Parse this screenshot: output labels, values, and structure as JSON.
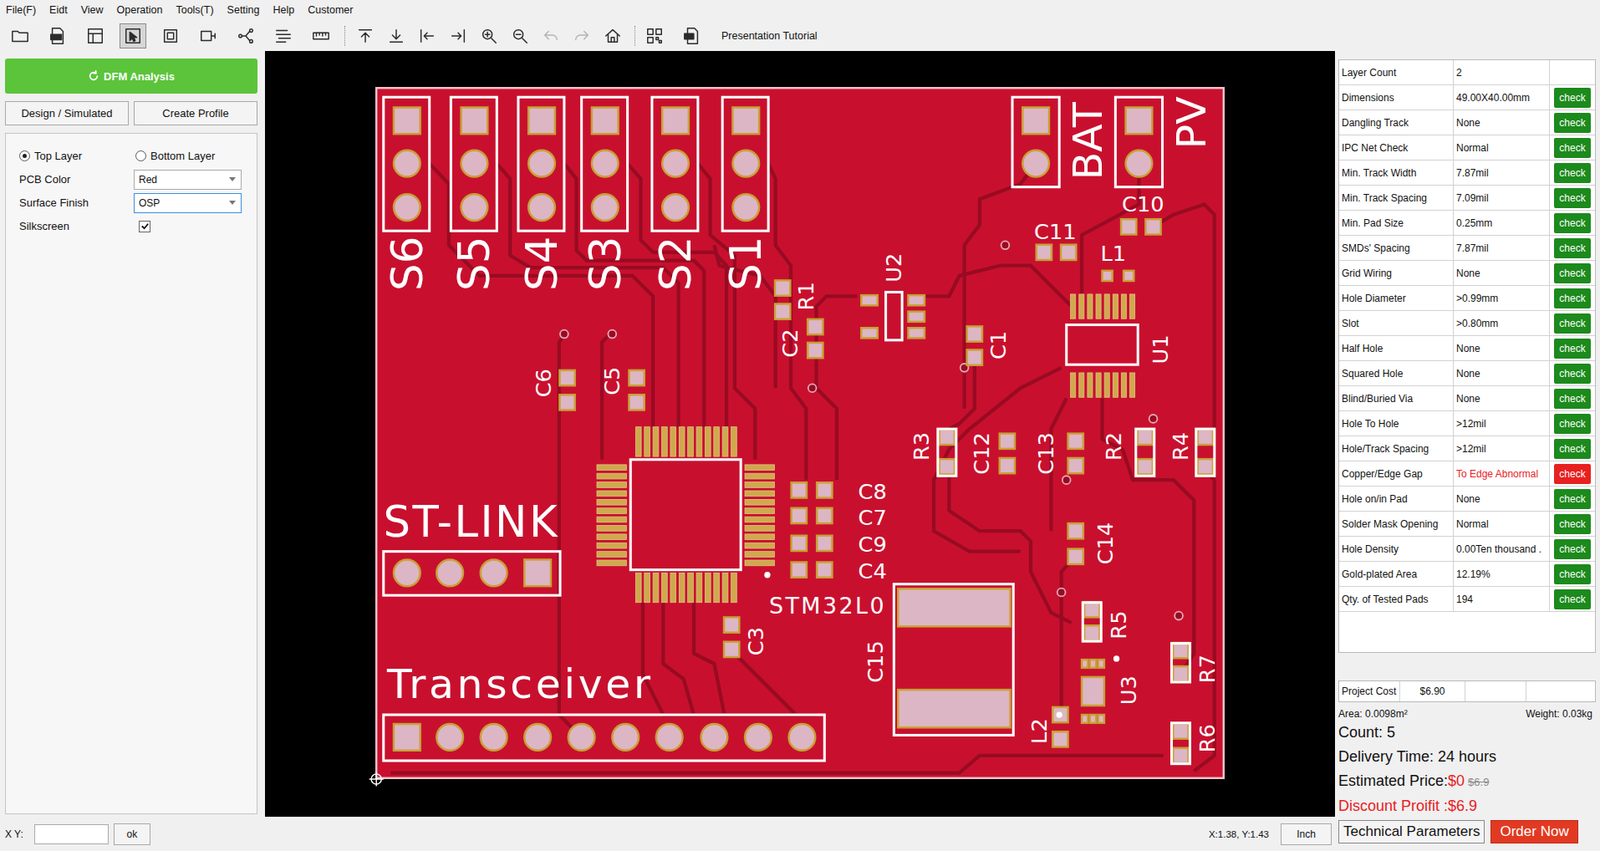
{
  "menu": [
    "File(F)",
    "Eidt",
    "View",
    "Operation",
    "Tools(T)",
    "Setting",
    "Help",
    "Customer"
  ],
  "toolbar": {
    "tools": [
      {
        "selected": false,
        "disabled": false
      },
      {
        "selected": false,
        "disabled": false
      },
      {
        "selected": false,
        "disabled": false
      },
      {
        "selected": true,
        "disabled": false
      },
      {
        "selected": false,
        "disabled": false
      },
      {
        "selected": false,
        "disabled": false
      },
      {
        "selected": false,
        "disabled": false
      },
      {
        "selected": false,
        "disabled": false
      },
      {
        "selected": false,
        "disabled": false
      },
      {
        "selected": false,
        "disabled": false
      },
      {
        "selected": false,
        "disabled": false
      },
      {
        "selected": false,
        "disabled": false
      },
      {
        "selected": false,
        "disabled": false
      },
      {
        "selected": false,
        "disabled": false
      },
      {
        "selected": false,
        "disabled": false
      },
      {
        "selected": false,
        "disabled": true
      },
      {
        "selected": false,
        "disabled": true
      },
      {
        "selected": false,
        "disabled": false
      },
      {
        "selected": false,
        "disabled": false
      },
      {
        "selected": false,
        "disabled": false
      }
    ],
    "tutorial": "Presentation Tutorial"
  },
  "left_panel": {
    "analyze_button": "DFM Analysis",
    "buttons": [
      "Design / Simulated",
      "Create Profile"
    ],
    "layers": [
      {
        "label": "Top Layer",
        "selected": true
      },
      {
        "label": "Bottom Layer",
        "selected": false
      }
    ],
    "fields": [
      {
        "label": "PCB Color",
        "value": "Red",
        "focused": false
      },
      {
        "label": "Surface Finish",
        "value": "OSP",
        "focused": true
      }
    ],
    "silkscreen": {
      "label": "Silkscreen",
      "checked": true
    }
  },
  "board": {
    "labels": [
      {
        "text": "S6",
        "kind": "vertical"
      },
      {
        "text": "S5",
        "kind": "vertical"
      },
      {
        "text": "S4",
        "kind": "vertical"
      },
      {
        "text": "S3",
        "kind": "vertical"
      },
      {
        "text": "S2",
        "kind": "vertical"
      },
      {
        "text": "S1",
        "kind": "vertical"
      },
      {
        "text": "BAT",
        "kind": "vertical"
      },
      {
        "text": "PV",
        "kind": "vertical"
      },
      {
        "text": "C10",
        "kind": "horizontal"
      },
      {
        "text": "C11",
        "kind": "horizontal"
      },
      {
        "text": "L1",
        "kind": "horizontal"
      },
      {
        "text": "U2",
        "kind": "vertical"
      },
      {
        "text": "R1",
        "kind": "vertical"
      },
      {
        "text": "C2",
        "kind": "vertical"
      },
      {
        "text": "C1",
        "kind": "vertical"
      },
      {
        "text": "U1",
        "kind": "vertical"
      },
      {
        "text": "C6",
        "kind": "vertical"
      },
      {
        "text": "C5",
        "kind": "vertical"
      },
      {
        "text": "R3",
        "kind": "vertical"
      },
      {
        "text": "C12",
        "kind": "vertical"
      },
      {
        "text": "C13",
        "kind": "vertical"
      },
      {
        "text": "R2",
        "kind": "vertical"
      },
      {
        "text": "R4",
        "kind": "vertical"
      },
      {
        "text": "C8",
        "kind": "horizontal"
      },
      {
        "text": "C7",
        "kind": "horizontal"
      },
      {
        "text": "C9",
        "kind": "horizontal"
      },
      {
        "text": "C4",
        "kind": "horizontal"
      },
      {
        "text": "STM32L0",
        "kind": "horizontal"
      },
      {
        "text": "ST-LINK",
        "kind": "horizontal"
      },
      {
        "text": "C14",
        "kind": "vertical"
      },
      {
        "text": "C3",
        "kind": "vertical"
      },
      {
        "text": "C15",
        "kind": "vertical"
      },
      {
        "text": "R5",
        "kind": "vertical"
      },
      {
        "text": "U3",
        "kind": "vertical"
      },
      {
        "text": "R7",
        "kind": "vertical"
      },
      {
        "text": "L2",
        "kind": "vertical"
      },
      {
        "text": "R6",
        "kind": "vertical"
      },
      {
        "text": "Transceiver",
        "kind": "horizontal"
      }
    ]
  },
  "checks": [
    {
      "label": "Layer Count",
      "value": "2",
      "check": null,
      "abnormal": false
    },
    {
      "label": "Dimensions",
      "value": "49.00X40.00mm",
      "check": "check",
      "abnormal": false
    },
    {
      "label": "Dangling Track",
      "value": "None",
      "check": "check",
      "abnormal": false
    },
    {
      "label": "IPC Net Check",
      "value": "Normal",
      "check": "check",
      "abnormal": false
    },
    {
      "label": "Min. Track Width",
      "value": "7.87mil",
      "check": "check",
      "abnormal": false
    },
    {
      "label": "Min. Track Spacing",
      "value": "7.09mil",
      "check": "check",
      "abnormal": false
    },
    {
      "label": "Min. Pad Size",
      "value": "0.25mm",
      "check": "check",
      "abnormal": false
    },
    {
      "label": "SMDs' Spacing",
      "value": "7.87mil",
      "check": "check",
      "abnormal": false
    },
    {
      "label": "Grid Wiring",
      "value": "None",
      "check": "check",
      "abnormal": false
    },
    {
      "label": "Hole Diameter",
      "value": ">0.99mm",
      "check": "check",
      "abnormal": false
    },
    {
      "label": "Slot",
      "value": ">0.80mm",
      "check": "check",
      "abnormal": false
    },
    {
      "label": "Half Hole",
      "value": "None",
      "check": "check",
      "abnormal": false
    },
    {
      "label": "Squared Hole",
      "value": "None",
      "check": "check",
      "abnormal": false
    },
    {
      "label": "Blind/Buried Via",
      "value": "None",
      "check": "check",
      "abnormal": false
    },
    {
      "label": "Hole To Hole",
      "value": ">12mil",
      "check": "check",
      "abnormal": false
    },
    {
      "label": "Hole/Track Spacing",
      "value": ">12mil",
      "check": "check",
      "abnormal": false
    },
    {
      "label": "Copper/Edge Gap",
      "value": "To Edge Abnormal",
      "check": "check",
      "abnormal": true
    },
    {
      "label": "Hole on/in Pad",
      "value": "None",
      "check": "check",
      "abnormal": false
    },
    {
      "label": "Solder Mask Opening",
      "value": "Normal",
      "check": "check",
      "abnormal": false
    },
    {
      "label": "Hole Density",
      "value": "0.00Ten thousand .",
      "check": "check",
      "abnormal": false
    },
    {
      "label": "Gold-plated Area",
      "value": "12.19%",
      "check": "check",
      "abnormal": false
    },
    {
      "label": "Qty. of Tested Pads",
      "value": "194",
      "check": "check",
      "abnormal": false
    }
  ],
  "summary": {
    "cost": {
      "label": "Project Cost",
      "value": "$6.90"
    },
    "area": "Area: 0.0098m²",
    "weight": "Weight: 0.03kg",
    "count": "Count: 5",
    "delivery": "Delivery Time: 24 hours",
    "estimate": {
      "label": "Estimated Price:",
      "price": "$0",
      "original": "$6.9"
    },
    "discount": "Discount Proifit :$6.9",
    "buttons": [
      {
        "label": "Technical Parameters",
        "primary": false
      },
      {
        "label": "Order Now",
        "primary": true
      }
    ]
  },
  "status_bar": {
    "xy_label": "X Y:",
    "xy_value": "",
    "ok": "ok",
    "coords": "X:1.38, Y:1.43",
    "unit": "Inch"
  }
}
